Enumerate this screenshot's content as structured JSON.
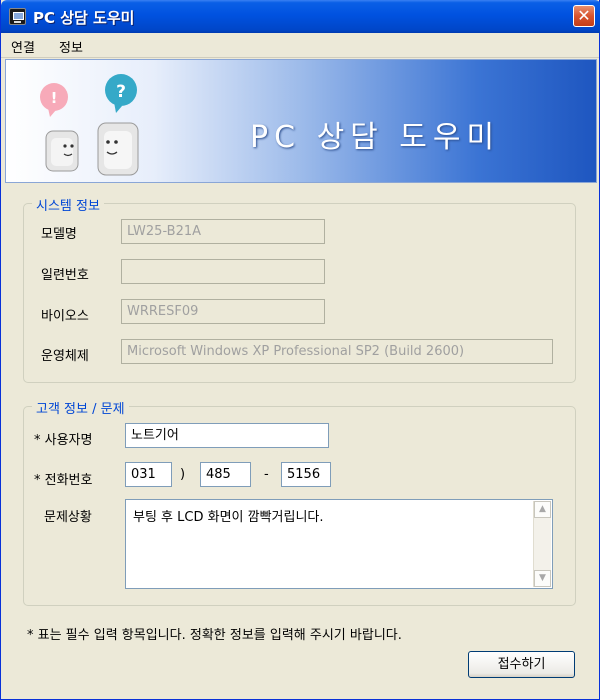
{
  "window": {
    "title": "PC 상담 도우미",
    "close_glyph": "✕"
  },
  "menu": {
    "items": [
      "연결",
      "정보"
    ]
  },
  "banner": {
    "title": "PC 상담 도우미"
  },
  "system_info": {
    "legend": "시스템 정보",
    "model_label": "모델명",
    "model_value": "LW25-B21A",
    "serial_label": "일련번호",
    "serial_value": "",
    "bios_label": "바이오스",
    "bios_value": "WRRESF09",
    "os_label": "운영체제",
    "os_value": "Microsoft Windows XP Professional SP2 (Build 2600)"
  },
  "customer": {
    "legend": "고객 정보 / 문제",
    "user_label": "* 사용자명",
    "user_value": "노트기어",
    "phone_label": "* 전화번호",
    "phone_1": "031",
    "phone_sep1": ")",
    "phone_2": "485",
    "phone_sep2": "-",
    "phone_3": "5156",
    "problem_label": "문제상황",
    "problem_value": "부팅 후 LCD 화면이 깜빡거립니다."
  },
  "note": "* 표는 필수 입력 항목입니다.  정확한 정보를 입력해 주시기 바랍니다.",
  "submit_label": "접수하기"
}
